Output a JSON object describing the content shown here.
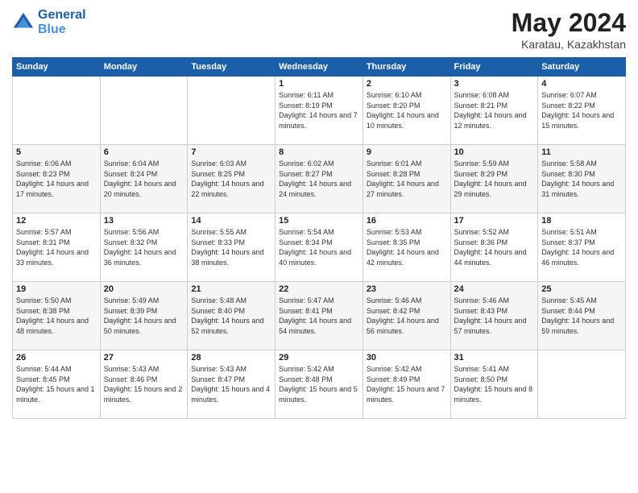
{
  "header": {
    "logo_line1": "General",
    "logo_line2": "Blue",
    "main_title": "May 2024",
    "subtitle": "Karatau, Kazakhstan"
  },
  "weekdays": [
    "Sunday",
    "Monday",
    "Tuesday",
    "Wednesday",
    "Thursday",
    "Friday",
    "Saturday"
  ],
  "weeks": [
    [
      {
        "day": "",
        "sunrise": "",
        "sunset": "",
        "daylight": ""
      },
      {
        "day": "",
        "sunrise": "",
        "sunset": "",
        "daylight": ""
      },
      {
        "day": "",
        "sunrise": "",
        "sunset": "",
        "daylight": ""
      },
      {
        "day": "1",
        "sunrise": "Sunrise: 6:11 AM",
        "sunset": "Sunset: 8:19 PM",
        "daylight": "Daylight: 14 hours and 7 minutes."
      },
      {
        "day": "2",
        "sunrise": "Sunrise: 6:10 AM",
        "sunset": "Sunset: 8:20 PM",
        "daylight": "Daylight: 14 hours and 10 minutes."
      },
      {
        "day": "3",
        "sunrise": "Sunrise: 6:08 AM",
        "sunset": "Sunset: 8:21 PM",
        "daylight": "Daylight: 14 hours and 12 minutes."
      },
      {
        "day": "4",
        "sunrise": "Sunrise: 6:07 AM",
        "sunset": "Sunset: 8:22 PM",
        "daylight": "Daylight: 14 hours and 15 minutes."
      }
    ],
    [
      {
        "day": "5",
        "sunrise": "Sunrise: 6:06 AM",
        "sunset": "Sunset: 8:23 PM",
        "daylight": "Daylight: 14 hours and 17 minutes."
      },
      {
        "day": "6",
        "sunrise": "Sunrise: 6:04 AM",
        "sunset": "Sunset: 8:24 PM",
        "daylight": "Daylight: 14 hours and 20 minutes."
      },
      {
        "day": "7",
        "sunrise": "Sunrise: 6:03 AM",
        "sunset": "Sunset: 8:25 PM",
        "daylight": "Daylight: 14 hours and 22 minutes."
      },
      {
        "day": "8",
        "sunrise": "Sunrise: 6:02 AM",
        "sunset": "Sunset: 8:27 PM",
        "daylight": "Daylight: 14 hours and 24 minutes."
      },
      {
        "day": "9",
        "sunrise": "Sunrise: 6:01 AM",
        "sunset": "Sunset: 8:28 PM",
        "daylight": "Daylight: 14 hours and 27 minutes."
      },
      {
        "day": "10",
        "sunrise": "Sunrise: 5:59 AM",
        "sunset": "Sunset: 8:29 PM",
        "daylight": "Daylight: 14 hours and 29 minutes."
      },
      {
        "day": "11",
        "sunrise": "Sunrise: 5:58 AM",
        "sunset": "Sunset: 8:30 PM",
        "daylight": "Daylight: 14 hours and 31 minutes."
      }
    ],
    [
      {
        "day": "12",
        "sunrise": "Sunrise: 5:57 AM",
        "sunset": "Sunset: 8:31 PM",
        "daylight": "Daylight: 14 hours and 33 minutes."
      },
      {
        "day": "13",
        "sunrise": "Sunrise: 5:56 AM",
        "sunset": "Sunset: 8:32 PM",
        "daylight": "Daylight: 14 hours and 36 minutes."
      },
      {
        "day": "14",
        "sunrise": "Sunrise: 5:55 AM",
        "sunset": "Sunset: 8:33 PM",
        "daylight": "Daylight: 14 hours and 38 minutes."
      },
      {
        "day": "15",
        "sunrise": "Sunrise: 5:54 AM",
        "sunset": "Sunset: 8:34 PM",
        "daylight": "Daylight: 14 hours and 40 minutes."
      },
      {
        "day": "16",
        "sunrise": "Sunrise: 5:53 AM",
        "sunset": "Sunset: 8:35 PM",
        "daylight": "Daylight: 14 hours and 42 minutes."
      },
      {
        "day": "17",
        "sunrise": "Sunrise: 5:52 AM",
        "sunset": "Sunset: 8:36 PM",
        "daylight": "Daylight: 14 hours and 44 minutes."
      },
      {
        "day": "18",
        "sunrise": "Sunrise: 5:51 AM",
        "sunset": "Sunset: 8:37 PM",
        "daylight": "Daylight: 14 hours and 46 minutes."
      }
    ],
    [
      {
        "day": "19",
        "sunrise": "Sunrise: 5:50 AM",
        "sunset": "Sunset: 8:38 PM",
        "daylight": "Daylight: 14 hours and 48 minutes."
      },
      {
        "day": "20",
        "sunrise": "Sunrise: 5:49 AM",
        "sunset": "Sunset: 8:39 PM",
        "daylight": "Daylight: 14 hours and 50 minutes."
      },
      {
        "day": "21",
        "sunrise": "Sunrise: 5:48 AM",
        "sunset": "Sunset: 8:40 PM",
        "daylight": "Daylight: 14 hours and 52 minutes."
      },
      {
        "day": "22",
        "sunrise": "Sunrise: 5:47 AM",
        "sunset": "Sunset: 8:41 PM",
        "daylight": "Daylight: 14 hours and 54 minutes."
      },
      {
        "day": "23",
        "sunrise": "Sunrise: 5:46 AM",
        "sunset": "Sunset: 8:42 PM",
        "daylight": "Daylight: 14 hours and 56 minutes."
      },
      {
        "day": "24",
        "sunrise": "Sunrise: 5:46 AM",
        "sunset": "Sunset: 8:43 PM",
        "daylight": "Daylight: 14 hours and 57 minutes."
      },
      {
        "day": "25",
        "sunrise": "Sunrise: 5:45 AM",
        "sunset": "Sunset: 8:44 PM",
        "daylight": "Daylight: 14 hours and 59 minutes."
      }
    ],
    [
      {
        "day": "26",
        "sunrise": "Sunrise: 5:44 AM",
        "sunset": "Sunset: 8:45 PM",
        "daylight": "Daylight: 15 hours and 1 minute."
      },
      {
        "day": "27",
        "sunrise": "Sunrise: 5:43 AM",
        "sunset": "Sunset: 8:46 PM",
        "daylight": "Daylight: 15 hours and 2 minutes."
      },
      {
        "day": "28",
        "sunrise": "Sunrise: 5:43 AM",
        "sunset": "Sunset: 8:47 PM",
        "daylight": "Daylight: 15 hours and 4 minutes."
      },
      {
        "day": "29",
        "sunrise": "Sunrise: 5:42 AM",
        "sunset": "Sunset: 8:48 PM",
        "daylight": "Daylight: 15 hours and 5 minutes."
      },
      {
        "day": "30",
        "sunrise": "Sunrise: 5:42 AM",
        "sunset": "Sunset: 8:49 PM",
        "daylight": "Daylight: 15 hours and 7 minutes."
      },
      {
        "day": "31",
        "sunrise": "Sunrise: 5:41 AM",
        "sunset": "Sunset: 8:50 PM",
        "daylight": "Daylight: 15 hours and 8 minutes."
      },
      {
        "day": "",
        "sunrise": "",
        "sunset": "",
        "daylight": ""
      }
    ]
  ]
}
